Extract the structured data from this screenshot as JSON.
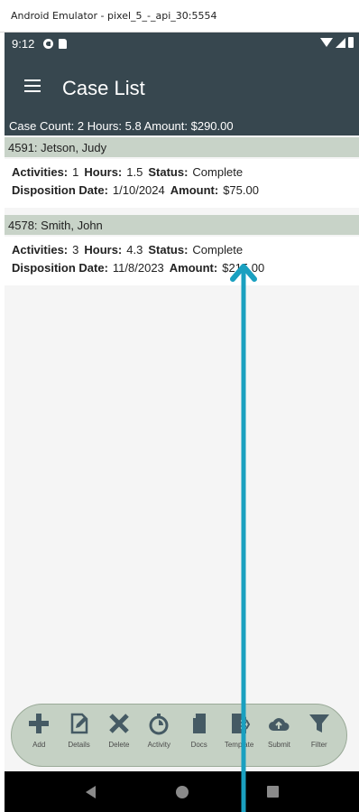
{
  "window": {
    "title": "Android Emulator - pixel_5_-_api_30:5554"
  },
  "status_bar": {
    "time": "9:12",
    "icons": [
      "notification-icon",
      "sd-card-icon",
      "wifi-icon",
      "signal-icon",
      "battery-icon"
    ]
  },
  "app_bar": {
    "title": "Case List",
    "menu_icon": "hamburger-menu-icon"
  },
  "summary": {
    "text": "Case Count: 2 Hours: 5.8 Amount: $290.00"
  },
  "labels": {
    "activities": "Activities:",
    "hours": "Hours:",
    "status": "Status:",
    "disposition_date": "Disposition Date:",
    "amount": "Amount:"
  },
  "cases": [
    {
      "header": "4591: Jetson, Judy",
      "activities": "1",
      "hours": "1.5",
      "status": "Complete",
      "disposition_date": "1/10/2024",
      "amount": "$75.00"
    },
    {
      "header": "4578: Smith, John",
      "activities": "3",
      "hours": "4.3",
      "status": "Complete",
      "disposition_date": "11/8/2023",
      "amount": "$215.00"
    }
  ],
  "toolbar": {
    "add": "Add",
    "details": "Details",
    "delete": "Delete",
    "activity": "Activity",
    "docs": "Docs",
    "template": "Template",
    "submit": "Submit",
    "filter": "Filter"
  },
  "colors": {
    "app_bar": "#37474f",
    "case_header": "#c8d3c8",
    "toolbar": "#c5d1c4",
    "annotation_arrow": "#1aa0c0"
  }
}
